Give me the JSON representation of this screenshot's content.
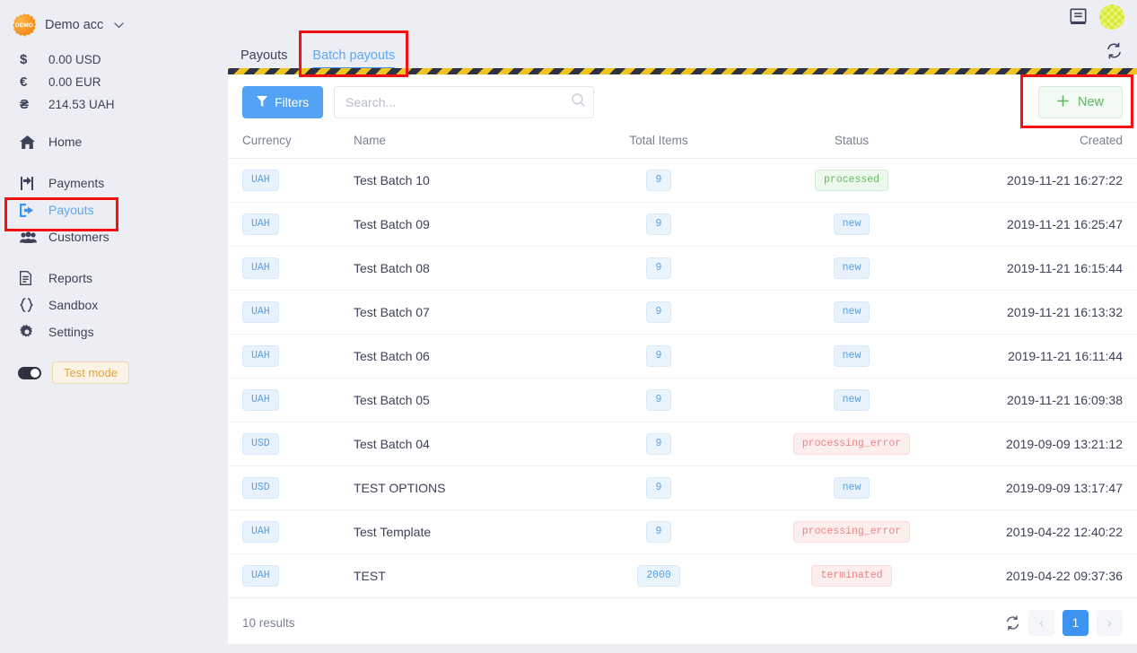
{
  "sidebar": {
    "account": {
      "badge_text": "DEMO",
      "name": "Demo acc",
      "caret": "⌄"
    },
    "balances": [
      {
        "symbol": "$",
        "amount": "0.00 USD"
      },
      {
        "symbol": "€",
        "amount": "0.00 EUR"
      },
      {
        "symbol": "₴",
        "amount": "214.53 UAH"
      }
    ],
    "nav_group_1": [
      {
        "icon": "home-icon",
        "label": "Home",
        "active": false
      }
    ],
    "nav_group_2": [
      {
        "icon": "payments-icon",
        "label": "Payments",
        "active": false
      },
      {
        "icon": "payouts-icon",
        "label": "Payouts",
        "active": true
      },
      {
        "icon": "customers-icon",
        "label": "Customers",
        "active": false
      }
    ],
    "nav_group_3": [
      {
        "icon": "reports-icon",
        "label": "Reports",
        "active": false
      },
      {
        "icon": "sandbox-icon",
        "label": "Sandbox",
        "active": false
      },
      {
        "icon": "settings-icon",
        "label": "Settings",
        "active": false
      }
    ],
    "test_mode": {
      "label": "Test mode",
      "enabled": true
    }
  },
  "topbar": {
    "docs_icon": "book-icon",
    "avatar_icon": "identicon-avatar"
  },
  "tabs": [
    {
      "label": "Payouts",
      "active": false
    },
    {
      "label": "Batch payouts",
      "active": true
    }
  ],
  "tabbar": {
    "refresh_icon": "refresh-icon"
  },
  "toolbar": {
    "filters_label": "Filters",
    "filters_icon": "funnel-icon",
    "search_placeholder": "Search...",
    "search_value": "",
    "search_icon": "search-icon",
    "new_label": "New",
    "new_icon": "plus-icon"
  },
  "table": {
    "columns": [
      "Currency",
      "Name",
      "Total Items",
      "Status",
      "Created"
    ],
    "rows": [
      {
        "currency": "UAH",
        "name": "Test Batch 10",
        "items": "9",
        "status": "processed",
        "status_kind": "processed",
        "created": "2019-11-21 16:27:22"
      },
      {
        "currency": "UAH",
        "name": "Test Batch 09",
        "items": "9",
        "status": "new",
        "status_kind": "new",
        "created": "2019-11-21 16:25:47"
      },
      {
        "currency": "UAH",
        "name": "Test Batch 08",
        "items": "9",
        "status": "new",
        "status_kind": "new",
        "created": "2019-11-21 16:15:44"
      },
      {
        "currency": "UAH",
        "name": "Test Batch 07",
        "items": "9",
        "status": "new",
        "status_kind": "new",
        "created": "2019-11-21 16:13:32"
      },
      {
        "currency": "UAH",
        "name": "Test Batch 06",
        "items": "9",
        "status": "new",
        "status_kind": "new",
        "created": "2019-11-21 16:11:44"
      },
      {
        "currency": "UAH",
        "name": "Test Batch 05",
        "items": "9",
        "status": "new",
        "status_kind": "new",
        "created": "2019-11-21 16:09:38"
      },
      {
        "currency": "USD",
        "name": "Test Batch 04",
        "items": "9",
        "status": "processing_error",
        "status_kind": "error",
        "created": "2019-09-09 13:21:12"
      },
      {
        "currency": "USD",
        "name": "TEST OPTIONS",
        "items": "9",
        "status": "new",
        "status_kind": "new",
        "created": "2019-09-09 13:17:47"
      },
      {
        "currency": "UAH",
        "name": "Test Template",
        "items": "9",
        "status": "processing_error",
        "status_kind": "error",
        "created": "2019-04-22 12:40:22"
      },
      {
        "currency": "UAH",
        "name": "TEST",
        "items": "2000",
        "status": "terminated",
        "status_kind": "terminated",
        "created": "2019-04-22 09:37:36"
      }
    ]
  },
  "footer": {
    "results_text": "10 results",
    "refresh_icon": "refresh-icon",
    "prev_label": "‹",
    "pages": [
      "1"
    ],
    "current_page": "1",
    "next_label": "›"
  },
  "annotations": {
    "payouts_box": "highlight-sidebar-payouts",
    "tab_box": "highlight-batch-payouts-tab",
    "new_box": "highlight-new-button"
  },
  "colors": {
    "accent_blue": "#3c94f0",
    "filters_blue": "#52a2f5",
    "success_green": "#5cb85c",
    "error_red": "#ef8383",
    "annotation_red": "#f51111",
    "hazard_yellow": "#f0c420",
    "hazard_dark": "#2f3242",
    "sidebar_bg": "#eceef4",
    "test_mode_orange": "#e8a33d"
  }
}
